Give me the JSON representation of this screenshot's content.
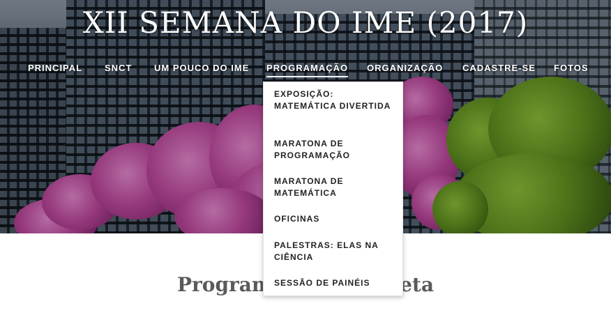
{
  "site": {
    "title": "XII SEMANA DO IME (2017)"
  },
  "nav": {
    "items": [
      {
        "label": "PRINCIPAL"
      },
      {
        "label": "SNCT"
      },
      {
        "label": "UM POUCO DO IME"
      },
      {
        "label": "PROGRAMAÇÃO",
        "active": true
      },
      {
        "label": "ORGANIZAÇÃO"
      },
      {
        "label": "CADASTRE-SE"
      },
      {
        "label": "FOTOS"
      }
    ]
  },
  "dropdown": {
    "items": [
      {
        "label": "EXPOSIÇÃO: MATEMÁTICA DIVERTIDA"
      },
      {
        "label": "MARATONA DE PROGRAMAÇÃO"
      },
      {
        "label": "MARATONA DE MATEMÁTICA"
      },
      {
        "label": "OFICINAS"
      },
      {
        "label": "PALESTRAS: ELAS NA CIÊNCIA"
      },
      {
        "label": "SESSÃO DE PAINÉIS"
      }
    ]
  },
  "page": {
    "heading": "Programação Completa"
  },
  "colors": {
    "text_dark": "#222222",
    "heading": "#5a5a5a",
    "nav_text": "#ffffff"
  }
}
